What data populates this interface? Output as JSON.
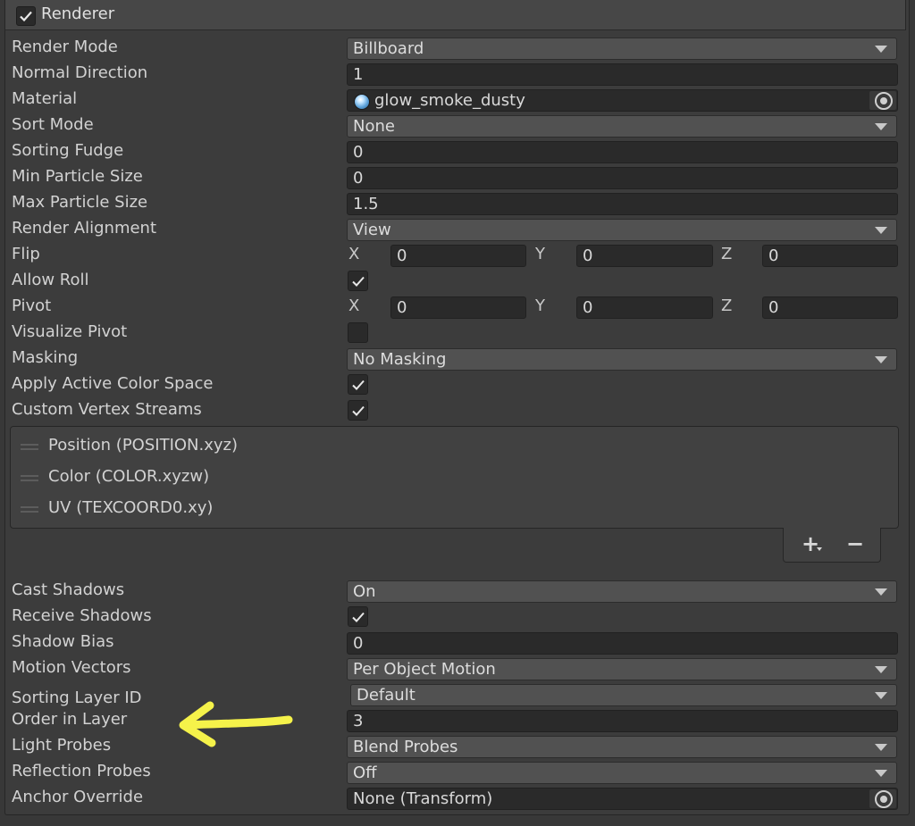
{
  "header": {
    "title": "Renderer",
    "enabled": true
  },
  "rows": {
    "render_mode": {
      "label": "Render Mode",
      "value": "Billboard"
    },
    "normal_direction": {
      "label": "Normal Direction",
      "value": "1"
    },
    "material": {
      "label": "Material",
      "value": "glow_smoke_dusty"
    },
    "sort_mode": {
      "label": "Sort Mode",
      "value": "None"
    },
    "sorting_fudge": {
      "label": "Sorting Fudge",
      "value": "0"
    },
    "min_particle_size": {
      "label": "Min Particle Size",
      "value": "0"
    },
    "max_particle_size": {
      "label": "Max Particle Size",
      "value": "1.5"
    },
    "render_alignment": {
      "label": "Render Alignment",
      "value": "View"
    },
    "flip": {
      "label": "Flip",
      "x_label": "X",
      "y_label": "Y",
      "z_label": "Z",
      "x": "0",
      "y": "0",
      "z": "0"
    },
    "allow_roll": {
      "label": "Allow Roll",
      "checked": true
    },
    "pivot": {
      "label": "Pivot",
      "x_label": "X",
      "y_label": "Y",
      "z_label": "Z",
      "x": "0",
      "y": "0",
      "z": "0"
    },
    "visualize_pivot": {
      "label": "Visualize Pivot",
      "checked": false
    },
    "masking": {
      "label": "Masking",
      "value": "No Masking"
    },
    "apply_active_color_space": {
      "label": "Apply Active Color Space",
      "checked": true
    },
    "custom_vertex_streams": {
      "label": "Custom Vertex Streams",
      "checked": true
    },
    "cast_shadows": {
      "label": "Cast Shadows",
      "value": "On"
    },
    "receive_shadows": {
      "label": "Receive Shadows",
      "checked": true
    },
    "shadow_bias": {
      "label": "Shadow Bias",
      "value": "0"
    },
    "motion_vectors": {
      "label": "Motion Vectors",
      "value": "Per Object Motion"
    },
    "sorting_layer_id": {
      "label": "Sorting Layer ID",
      "value": "Default"
    },
    "order_in_layer": {
      "label": "Order in Layer",
      "value": "3"
    },
    "light_probes": {
      "label": "Light Probes",
      "value": "Blend Probes"
    },
    "reflection_probes": {
      "label": "Reflection Probes",
      "value": "Off"
    },
    "anchor_override": {
      "label": "Anchor Override",
      "value": "None (Transform)"
    }
  },
  "streams": [
    "Position (POSITION.xyz)",
    "Color (COLOR.xyzw)",
    "UV (TEXCOORD0.xy)"
  ],
  "stream_buttons": {
    "add": "+",
    "remove": "−"
  },
  "colors": {
    "annotation_arrow": "#f5f24a",
    "panel_bg": "#3c3c3c",
    "field_bg": "#2a2a2a",
    "dropdown_bg": "#515151"
  }
}
